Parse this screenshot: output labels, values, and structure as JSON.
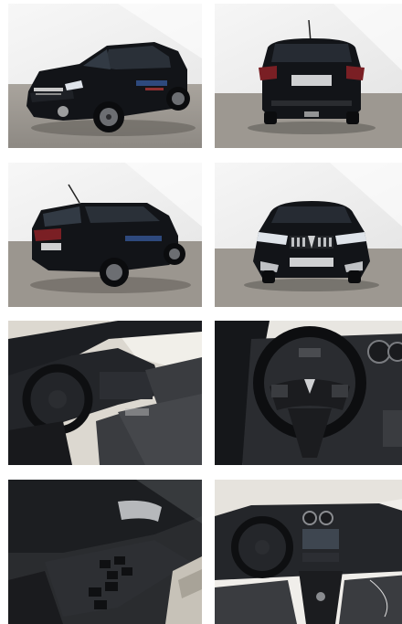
{
  "gallery": {
    "photos": [
      {
        "icon": "car-front-three-quarter-photo",
        "plate_text": ""
      },
      {
        "icon": "car-rear-photo",
        "plate_text": ""
      },
      {
        "icon": "car-rear-three-quarter-photo",
        "plate_text": ""
      },
      {
        "icon": "car-front-photo",
        "plate_text": ""
      },
      {
        "icon": "interior-driver-side-photo"
      },
      {
        "icon": "steering-wheel-photo"
      },
      {
        "icon": "door-panel-photo"
      },
      {
        "icon": "dashboard-photo"
      }
    ]
  },
  "colors": {
    "studio_wall": "#f2f2f2",
    "studio_floor": "#9a9690",
    "car_body": "#121418",
    "interior_dark": "#1c1e22",
    "seat_fabric": "#3a3c40"
  }
}
